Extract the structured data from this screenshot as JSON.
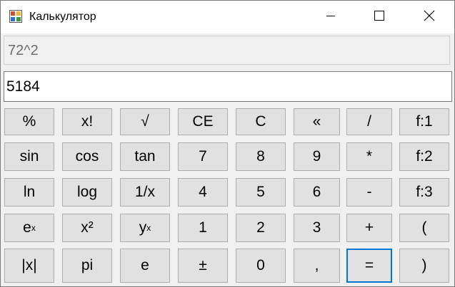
{
  "window": {
    "title": "Калькулятор",
    "icon": "calculator-app-icon",
    "controls": [
      "minimize-icon",
      "maximize-icon",
      "close-icon"
    ]
  },
  "display": {
    "expression": "72^2",
    "result": "5184"
  },
  "buttons": [
    [
      "%",
      "x!",
      "√",
      "CE",
      "C",
      "«",
      "/",
      "f:1"
    ],
    [
      "sin",
      "cos",
      "tan",
      "7",
      "8",
      "9",
      "*",
      "f:2"
    ],
    [
      "ln",
      "log",
      "1/x",
      "4",
      "5",
      "6",
      "-",
      "f:3"
    ],
    [
      {
        "base": "e",
        "sup": "x"
      },
      "x²",
      {
        "base": "y",
        "sup": "x"
      },
      "1",
      "2",
      "3",
      "+",
      "("
    ],
    [
      "|x|",
      "pi",
      "e",
      "±",
      "0",
      ",",
      "=",
      ")"
    ]
  ],
  "focused_button": "=",
  "colors": {
    "title_bar": "#ffffff",
    "window_bg": "#f0f0f0",
    "button_bg": "#e1e1e1",
    "button_border": "#adadad",
    "focus_border": "#0078d7",
    "expression_text": "#6d6d6d"
  }
}
